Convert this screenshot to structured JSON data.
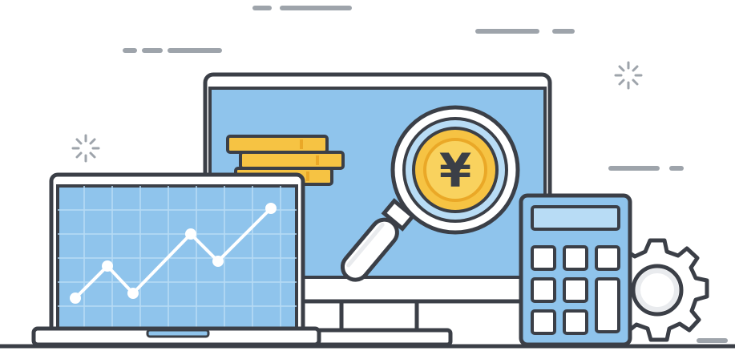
{
  "illustration": {
    "coin_symbol": "¥",
    "icons": [
      "laptop-icon",
      "monitor-icon",
      "magnifying-glass-icon",
      "yen-coin-icon",
      "coin-stack-icon",
      "calculator-icon",
      "gear-icon",
      "sparkle-icon"
    ]
  },
  "colors": {
    "outline": "#3b3f47",
    "screen_blue": "#8fc4ec",
    "screen_blue_light": "#b8dcf5",
    "gold": "#f6c343",
    "gold_dark": "#eaa827",
    "white": "#ffffff",
    "gray_dash": "#9ea4ab"
  }
}
